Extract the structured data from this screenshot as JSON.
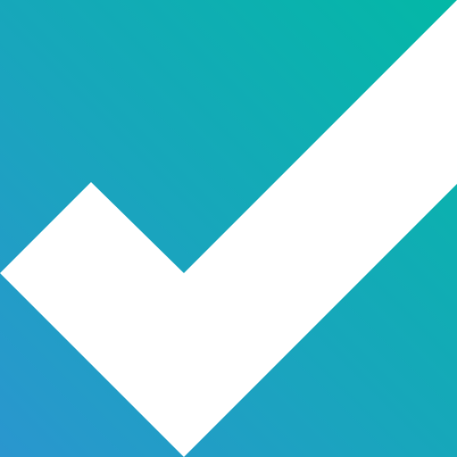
{
  "icon": {
    "name": "checkmark-icon",
    "colors": {
      "gradient_start": "#2a96cf",
      "gradient_end": "#03b8a6",
      "check": "#ffffff"
    }
  }
}
